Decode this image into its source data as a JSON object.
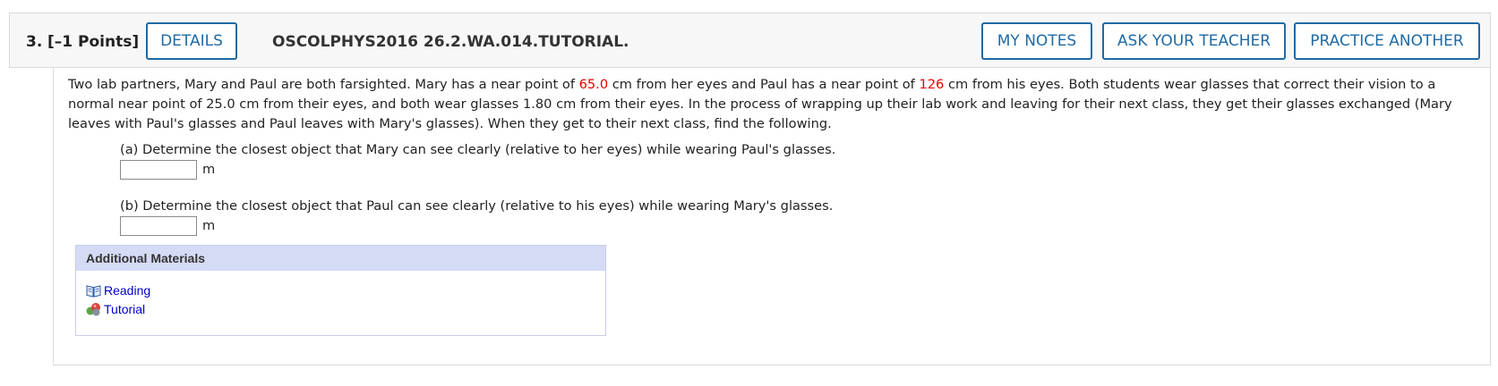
{
  "question": {
    "number": "3.",
    "points": "[–1 Points]",
    "details_label": "DETAILS",
    "code": "OSCOLPHYS2016 26.2.WA.014.TUTORIAL.",
    "my_notes_label": "MY NOTES",
    "ask_teacher_label": "ASK YOUR TEACHER",
    "practice_label": "PRACTICE ANOTHER"
  },
  "body": {
    "p1": "Two lab partners, Mary and Paul are both farsighted. Mary has a near point of ",
    "mary_near_point": "65.0",
    "p2": " cm from her eyes and Paul has a near point of ",
    "paul_near_point": "126",
    "p3": " cm from his eyes. Both students wear glasses that correct their vision to a normal near point of 25.0 cm from their eyes, and both wear glasses 1.80 cm from their eyes. In the process of wrapping up their lab work and leaving for their next class, they get their glasses exchanged (Mary leaves with Paul's glasses and Paul leaves with Mary's glasses). When they get to their next class, find the following.",
    "highlight_color": "#e00000"
  },
  "parts": [
    {
      "prompt": "(a) Determine the closest object that Mary can see clearly (relative to her eyes) while wearing Paul's glasses.",
      "value": "",
      "unit": "m"
    },
    {
      "prompt": "(b) Determine the closest object that Paul can see clearly (relative to his eyes) while wearing Mary's glasses.",
      "value": "",
      "unit": "m"
    }
  ],
  "materials": {
    "title": "Additional Materials",
    "links": [
      {
        "label": "Reading",
        "icon": "book-icon"
      },
      {
        "label": "Tutorial",
        "icon": "tutorial-icon"
      }
    ]
  },
  "colors": {
    "accent": "#1f6aa5",
    "link": "#0000cc",
    "materials_header": "#d5dbf5"
  }
}
